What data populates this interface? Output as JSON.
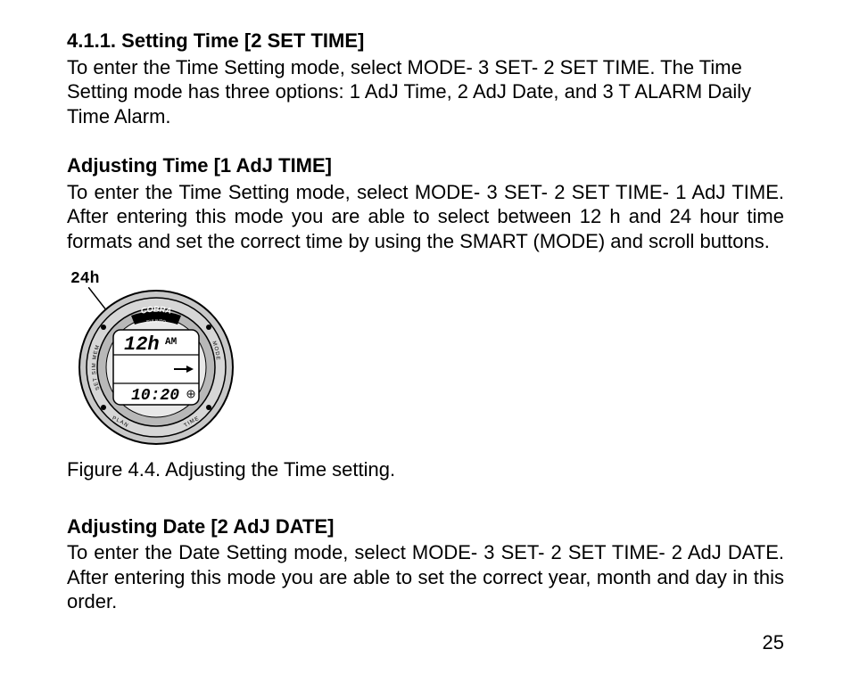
{
  "section": {
    "number": "4.1.1.",
    "title": "Setting Time [2 SET TIME]",
    "intro": "To enter the Time Setting mode, select MODE- 3 SET- 2 SET TIME. The Time Setting mode has three options: 1 AdJ Time, 2 AdJ Date, and 3 T ALARM Daily Time Alarm."
  },
  "sub1": {
    "title": "Adjusting Time [1 AdJ TIME]",
    "para": "To enter the Time Setting mode, select MODE- 3 SET- 2 SET TIME- 1 AdJ TIME. After entering this mode you are able to select between 12 h and 24 hour time formats and set the correct time by using the SMART (MODE) and scroll buttons."
  },
  "figure": {
    "annotation24h": "24h",
    "brand_top": "COBRA",
    "brand_sub": "SUUNTO",
    "bezel_left": "SET SIM MEM",
    "bezel_right": "MODE",
    "bezel_bl": "PLAN",
    "bezel_br": "TIME",
    "lcd_top_left": "12h",
    "lcd_top_right": "AM",
    "lcd_bottom": "10:20",
    "caption": "Figure 4.4. Adjusting the Time setting."
  },
  "sub2": {
    "title": "Adjusting Date [2 AdJ DATE]",
    "para": "To enter the Date Setting mode, select MODE- 3 SET- 2 SET TIME- 2 AdJ DATE. After entering this mode you are able to set the correct year, month and day in this order."
  },
  "page_number": "25"
}
